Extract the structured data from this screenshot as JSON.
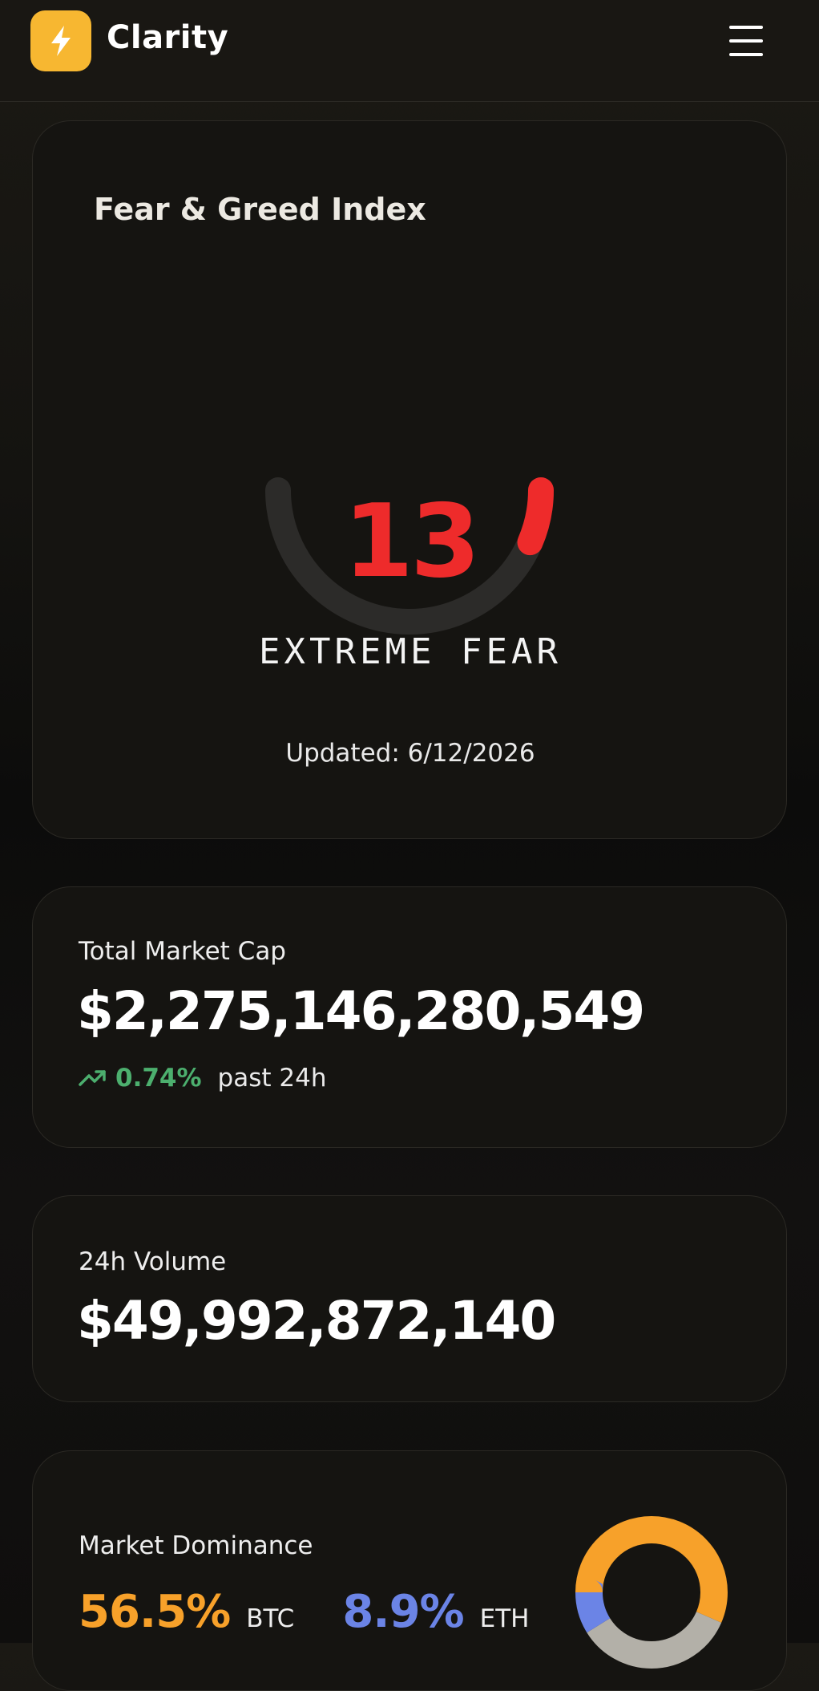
{
  "header": {
    "app_name": "Clarity",
    "logo_icon": "lightning-bolt-icon",
    "accent": "#f7b731",
    "menu_icon": "hamburger-menu-icon"
  },
  "fear_greed": {
    "title": "Fear & Greed Index",
    "value": "13",
    "score": 13,
    "scale_max": 100,
    "classification": "EXTREME FEAR",
    "updated": "Updated: 6/12/2026",
    "color": "#ee2b2b"
  },
  "market_cap": {
    "label": "Total Market Cap",
    "value": "$2,275,146,280,549",
    "change_icon": "trending-up-icon",
    "change": "0.74%",
    "change_period": "past 24h",
    "change_color": "#4caf6e"
  },
  "volume": {
    "label": "24h Volume",
    "value": "$49,992,872,140"
  },
  "dominance": {
    "label": "Market Dominance",
    "btc": {
      "pct": "56.5%",
      "coin": "BTC",
      "color": "#f7a12a",
      "share": 56.5
    },
    "eth": {
      "pct": "8.9%",
      "coin": "ETH",
      "color": "#6b84e6",
      "share": 8.9
    },
    "other_color": "#b3b0a8"
  }
}
